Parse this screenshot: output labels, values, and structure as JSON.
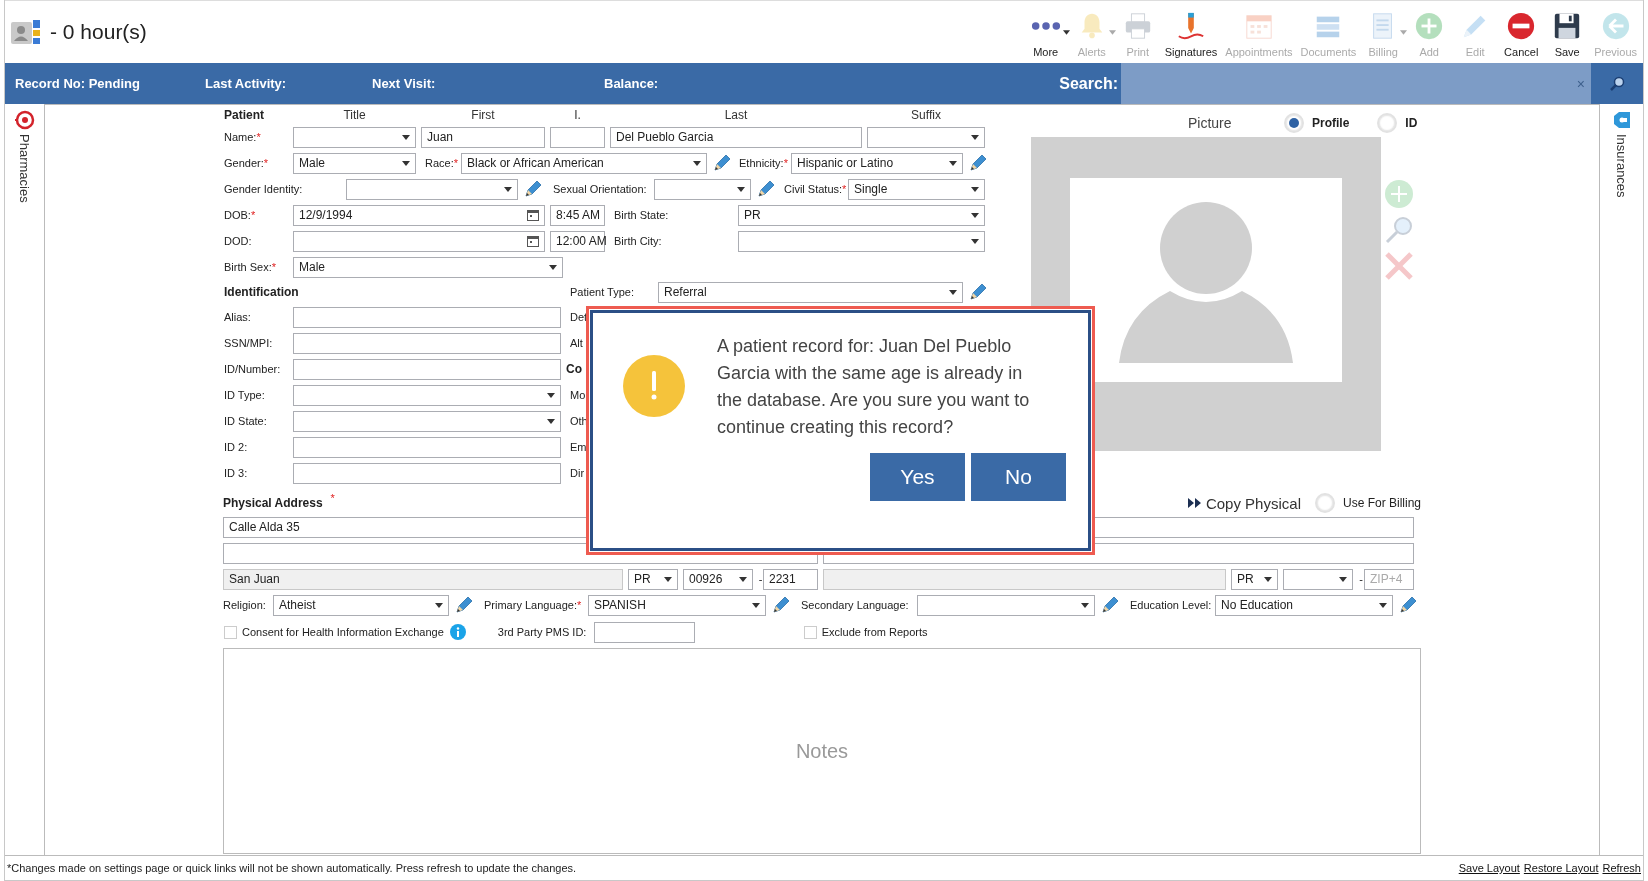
{
  "header": {
    "title": "- 0 hour(s)"
  },
  "toolbar": [
    {
      "label": "More",
      "kind": "more",
      "disabled": false,
      "dropdown": true
    },
    {
      "label": "Alerts",
      "kind": "bell",
      "disabled": true,
      "dropdown": true
    },
    {
      "label": "Print",
      "kind": "printer",
      "disabled": true,
      "dropdown": false
    },
    {
      "label": "Signatures",
      "kind": "signature",
      "disabled": false,
      "dropdown": false
    },
    {
      "label": "Appointments",
      "kind": "calendar",
      "disabled": true,
      "dropdown": false
    },
    {
      "label": "Documents",
      "kind": "documents",
      "disabled": true,
      "dropdown": false
    },
    {
      "label": "Billing",
      "kind": "billing",
      "disabled": true,
      "dropdown": true
    },
    {
      "label": "Add",
      "kind": "add",
      "disabled": true,
      "dropdown": false
    },
    {
      "label": "Edit",
      "kind": "edit",
      "disabled": true,
      "dropdown": false
    },
    {
      "label": "Cancel",
      "kind": "cancel",
      "disabled": false,
      "dropdown": false
    },
    {
      "label": "Save",
      "kind": "save",
      "disabled": false,
      "dropdown": false
    },
    {
      "label": "Previous",
      "kind": "previous",
      "disabled": true,
      "dropdown": false
    }
  ],
  "info_bar": {
    "items": [
      "Record No: Pending",
      "Last Activity:",
      "Next Visit:",
      "Balance:"
    ],
    "search_label": "Search:",
    "search_clear": "×"
  },
  "side_tabs": {
    "left": "Pharmacies",
    "right": "Insurances"
  },
  "patient": {
    "rows": [
      [
        {
          "kind": "heading",
          "text": "Patient"
        },
        {
          "kind": "caption",
          "text": "Title"
        },
        {
          "kind": "caption",
          "text": "First"
        },
        {
          "kind": "caption",
          "text": "I."
        },
        {
          "kind": "caption",
          "text": "Last"
        },
        {
          "kind": "caption",
          "text": "Suffix"
        }
      ],
      [
        {
          "kind": "label",
          "text": "Name:",
          "required": "*"
        },
        {
          "kind": "select"
        },
        {
          "kind": "input",
          "value": "Juan"
        },
        {
          "kind": "input"
        },
        {
          "kind": "input",
          "value": "Del Pueblo Garcia"
        },
        {
          "kind": "select"
        }
      ],
      [
        {
          "kind": "label",
          "text": "Gender:",
          "required": "*"
        },
        {
          "kind": "select",
          "value": "Male"
        },
        {
          "kind": "label",
          "text": "Race:",
          "required": "*"
        },
        {
          "kind": "select",
          "value": "Black or African American"
        },
        {
          "kind": "pencil"
        },
        {
          "kind": "label",
          "text": "Ethnicity:",
          "required": "*"
        },
        {
          "kind": "select",
          "value": "Hispanic or Latino"
        },
        {
          "kind": "pencil"
        }
      ],
      [
        {
          "kind": "label",
          "text": "Gender Identity:"
        },
        {
          "kind": "select"
        },
        {
          "kind": "pencil"
        },
        {
          "kind": "label",
          "text": "Sexual Orientation:"
        },
        {
          "kind": "select"
        },
        {
          "kind": "pencil"
        },
        {
          "kind": "label",
          "text": "Civil Status:",
          "required": "*"
        },
        {
          "kind": "select",
          "value": "Single"
        }
      ],
      [
        {
          "kind": "label",
          "text": "DOB:",
          "required": "*"
        },
        {
          "kind": "date",
          "value": "12/9/1994"
        },
        {
          "kind": "time",
          "value": "8:45 AM"
        },
        {
          "kind": "label",
          "text": "Birth State:"
        },
        {
          "kind": "select",
          "value": "PR"
        }
      ],
      [
        {
          "kind": "label",
          "text": "DOD:"
        },
        {
          "kind": "date"
        },
        {
          "kind": "time",
          "value": "12:00 AM"
        },
        {
          "kind": "label",
          "text": "Birth City:"
        },
        {
          "kind": "select"
        }
      ],
      [
        {
          "kind": "label",
          "text": "Birth Sex:",
          "required": "*"
        },
        {
          "kind": "select",
          "value": "Male"
        }
      ]
    ]
  },
  "identification": {
    "rows": [
      [
        {
          "kind": "heading",
          "text": "Identification"
        },
        {
          "kind": "label",
          "text": "Patient Type:"
        },
        {
          "kind": "select",
          "value": "Referral"
        },
        {
          "kind": "pencil"
        }
      ],
      [
        {
          "kind": "label",
          "text": "Alias:"
        },
        {
          "kind": "input"
        },
        {
          "kind": "label",
          "text": "Det"
        }
      ],
      [
        {
          "kind": "label",
          "text": "SSN/MPI:"
        },
        {
          "kind": "input"
        },
        {
          "kind": "label",
          "text": "Alt"
        }
      ],
      [
        {
          "kind": "label",
          "text": "ID/Number:"
        },
        {
          "kind": "input"
        },
        {
          "kind": "heading",
          "text": "Co"
        }
      ],
      [
        {
          "kind": "label",
          "text": "ID Type:"
        },
        {
          "kind": "select"
        },
        {
          "kind": "label",
          "text": "Mo"
        }
      ],
      [
        {
          "kind": "label",
          "text": "ID State:"
        },
        {
          "kind": "select"
        },
        {
          "kind": "label",
          "text": "Oth"
        }
      ],
      [
        {
          "kind": "label",
          "text": "ID 2:"
        },
        {
          "kind": "input"
        },
        {
          "kind": "label",
          "text": "Em"
        }
      ],
      [
        {
          "kind": "label",
          "text": "ID 3:"
        },
        {
          "kind": "input"
        },
        {
          "kind": "label",
          "text": "Dir"
        }
      ]
    ]
  },
  "picture": {
    "title": "Picture",
    "options": [
      {
        "label": "Profile",
        "selected": true
      },
      {
        "label": "ID",
        "selected": false
      }
    ]
  },
  "address": {
    "heading": "Physical Address",
    "required": "*",
    "copy_label": "Copy Physical",
    "use_for_billing": {
      "label": "Use For Billing",
      "checked": false
    },
    "rows": [
      [
        {
          "kind": "input",
          "value": "Calle Alda 35",
          "disabled": false
        },
        {
          "kind": "input",
          "disabled": false
        }
      ],
      [
        {
          "kind": "input",
          "disabled": false
        },
        {
          "kind": "input",
          "disabled": false
        }
      ],
      [
        {
          "kind": "input",
          "value": "San Juan",
          "disabled": true
        },
        {
          "kind": "select",
          "value": "PR",
          "disabled": false
        },
        {
          "kind": "select",
          "value": "00926",
          "disabled": false
        },
        {
          "kind": "sep",
          "text": "-"
        },
        {
          "kind": "input",
          "value": "2231",
          "disabled": false
        },
        {
          "kind": "input",
          "disabled": true
        },
        {
          "kind": "select",
          "value": "PR",
          "disabled": false
        },
        {
          "kind": "select",
          "disabled": false
        },
        {
          "kind": "sep",
          "text": "-"
        },
        {
          "kind": "input",
          "placeholder": "ZIP+4",
          "disabled": false
        }
      ]
    ]
  },
  "languages": [
    {
      "kind": "label",
      "text": "Religion:"
    },
    {
      "kind": "select",
      "value": "Atheist"
    },
    {
      "kind": "pencil"
    },
    {
      "kind": "label",
      "text": "Primary Language:",
      "required": "*"
    },
    {
      "kind": "select",
      "value": "SPANISH"
    },
    {
      "kind": "pencil"
    },
    {
      "kind": "label",
      "text": "Secondary Language:"
    },
    {
      "kind": "select"
    },
    {
      "kind": "pencil"
    },
    {
      "kind": "label",
      "text": "Education Level:"
    },
    {
      "kind": "select",
      "value": "No Education"
    },
    {
      "kind": "pencil"
    }
  ],
  "consent": {
    "checkbox": {
      "label": "Consent for Health Information Exchange",
      "checked": false
    },
    "pms_label": "3rd Party PMS ID:",
    "exclude": {
      "label": "Exclude from Reports",
      "checked": false
    }
  },
  "notes": {
    "placeholder": "Notes"
  },
  "dialog": {
    "message": "A patient record for: Juan Del Pueblo Garcia with the same age is already in the database. Are you sure you want to continue creating this record?",
    "buttons": [
      "Yes",
      "No"
    ]
  },
  "footer": {
    "note": "*Changes made on settings page or quick links will not be shown automatically. Press refresh to update the changes.",
    "links": [
      "Save Layout",
      "Restore Layout",
      "Refresh"
    ]
  }
}
